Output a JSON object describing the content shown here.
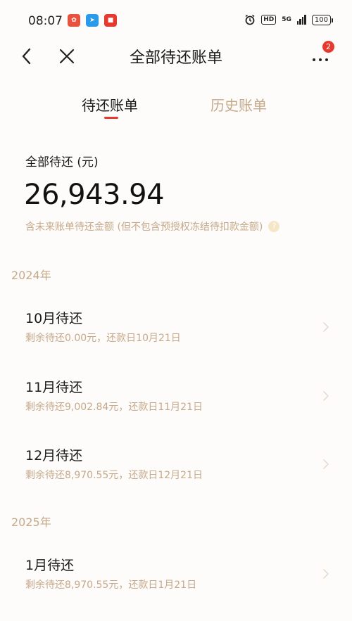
{
  "status": {
    "time": "08:07",
    "network": "5G",
    "battery": "100"
  },
  "nav": {
    "title": "全部待还账单",
    "more_badge": "2"
  },
  "tabs": [
    {
      "label": "待还账单",
      "active": true
    },
    {
      "label": "历史账单",
      "active": false
    }
  ],
  "summary": {
    "label": "全部待还 (元)",
    "amount": "26,943.94",
    "note": "含未来账单待还金额 (但不包含预授权冻结待扣款金额)"
  },
  "groups": [
    {
      "year": "2024年",
      "bills": [
        {
          "title": "10月待还",
          "sub": "剩余待还0.00元，还款日10月21日"
        },
        {
          "title": "11月待还",
          "sub": "剩余待还9,002.84元，还款日11月21日"
        },
        {
          "title": "12月待还",
          "sub": "剩余待还8,970.55元，还款日12月21日"
        }
      ]
    },
    {
      "year": "2025年",
      "bills": [
        {
          "title": "1月待还",
          "sub": "剩余待还8,970.55元，还款日1月21日"
        }
      ]
    }
  ],
  "colors": {
    "accent_red": "#e8392e",
    "muted_gold": "#c6a98a",
    "background": "#fdfcfa"
  }
}
